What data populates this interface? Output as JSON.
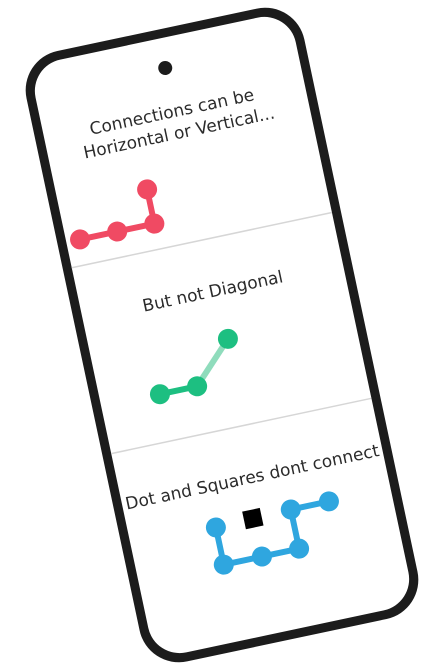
{
  "panels": [
    {
      "caption_lines": [
        "Connections can be",
        "Horizontal or Vertical..."
      ]
    },
    {
      "caption_lines": [
        "But not Diagonal"
      ]
    },
    {
      "caption_lines": [
        "Dot and Squares dont connect"
      ]
    }
  ],
  "colors": {
    "phone_frame": "#1c1c1c",
    "screen": "#ffffff",
    "divider": "#d6d6d6",
    "red_dot": "#f04a63",
    "green_dot": "#1dbf81",
    "green_faded_link": "#8fdcbc",
    "blue_dot": "#2fa6df",
    "square": "#000000"
  },
  "icons": [
    "front-camera-icon",
    "volume-button-icon",
    "power-button-icon",
    "black-square-icon"
  ]
}
